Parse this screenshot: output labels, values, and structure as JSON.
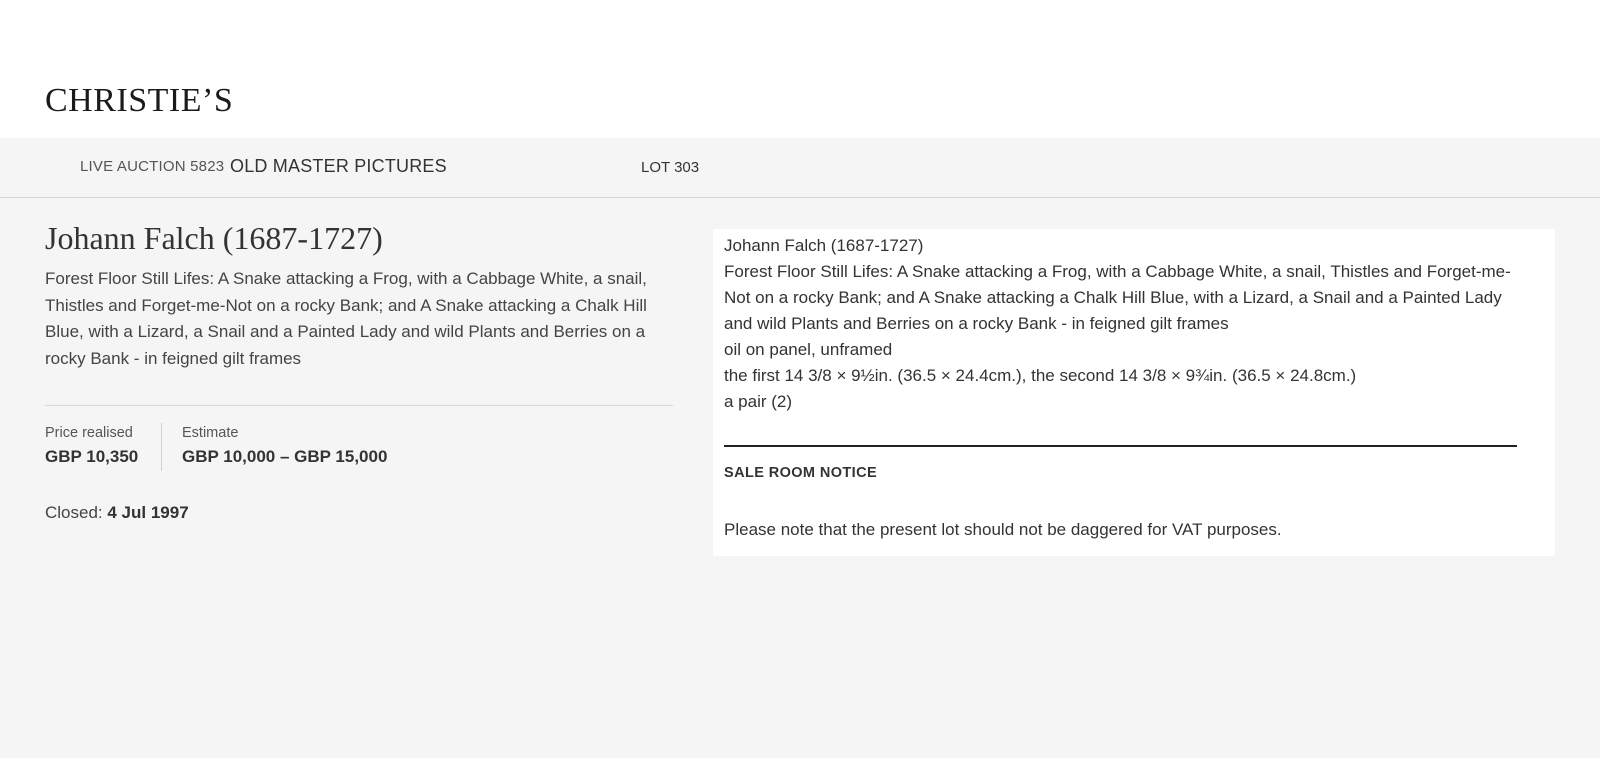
{
  "header": {
    "logo_text": "CHRISTIE’S"
  },
  "subnav": {
    "auction_type": "LIVE AUCTION 5823",
    "sale_title": "OLD MASTER PICTURES",
    "lot_label": "LOT 303"
  },
  "lot": {
    "artist": "Johann Falch (1687-1727)",
    "title": "Forest Floor Still Lifes: A Snake attacking a Frog, with a Cabbage White, a snail, Thistles and Forget-me-Not on a rocky Bank; and A Snake attacking a Chalk Hill Blue, with a Lizard, a Snail and a Painted Lady and wild Plants and Berries on a rocky Bank - in feigned gilt frames",
    "price_realised_label": "Price realised",
    "price_realised": "GBP 10,350",
    "estimate_label": "Estimate",
    "estimate": "GBP 10,000 – GBP 15,000",
    "closed_label": "Closed: ",
    "closed_date": "4 Jul 1997"
  },
  "details": {
    "artist": "Johann Falch (1687-1727)",
    "title": "Forest Floor Still Lifes: A Snake attacking a Frog, with a Cabbage White, a snail, Thistles and Forget-me-Not on a rocky Bank; and A Snake attacking a Chalk Hill Blue, with a Lizard, a Snail and a Painted Lady and wild Plants and Berries on a rocky Bank - in feigned gilt frames",
    "medium": "oil on panel, unframed",
    "dimensions": "the first 14 3/8 × 9½in. (36.5 × 24.4cm.), the second 14 3/8 × 9¾in. (36.5 × 24.8cm.)",
    "quantity": "a pair (2)",
    "notice_heading": "SALE ROOM NOTICE",
    "notice_text": "Please note that the present lot should not be daggered for VAT purposes."
  }
}
